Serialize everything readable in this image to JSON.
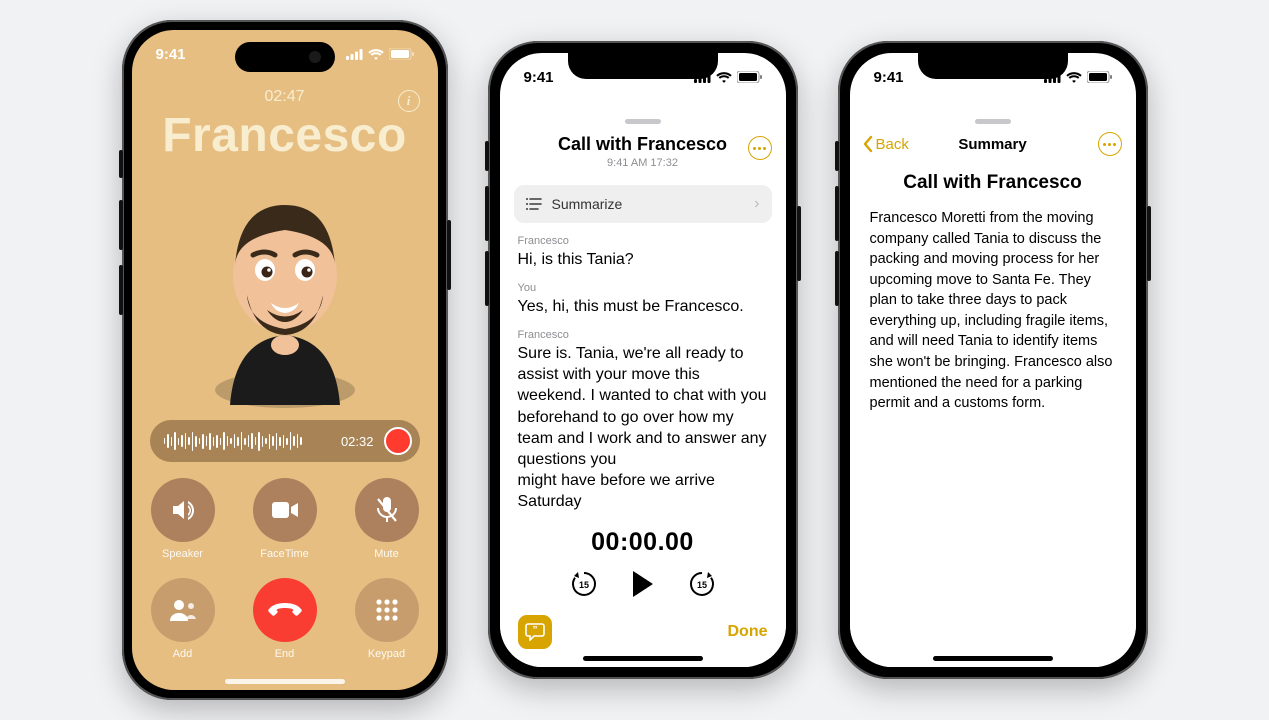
{
  "status_bar": {
    "time": "9:41"
  },
  "phone1": {
    "call_duration": "02:47",
    "caller_name": "Francesco",
    "recording_time": "02:32",
    "buttons": {
      "speaker": "Speaker",
      "facetime": "FaceTime",
      "mute": "Mute",
      "add": "Add",
      "end": "End",
      "keypad": "Keypad"
    }
  },
  "phone2": {
    "title": "Call with Francesco",
    "subtitle": "9:41 AM  17:32",
    "summarize_label": "Summarize",
    "transcript": [
      {
        "speaker": "Francesco",
        "text": "Hi, is this Tania?"
      },
      {
        "speaker": "You",
        "text": "Yes, hi, this must be Francesco."
      },
      {
        "speaker": "Francesco",
        "text": "Sure is. Tania, we're all ready to assist with your move this weekend. I wanted to chat with you beforehand to go over how my team and I work and to answer any questions you might have before we arrive Saturday"
      }
    ],
    "player_time": "00:00.00",
    "skip_seconds": "15",
    "done_label": "Done"
  },
  "phone3": {
    "back_label": "Back",
    "nav_title": "Summary",
    "heading": "Call with Francesco",
    "body": "Francesco Moretti from the moving company called Tania to discuss the packing and moving process for her upcoming move to Santa Fe. They plan to take three days to pack everything up, including fragile items, and will need Tania to identify items she won't be bringing. Francesco also mentioned the need for a parking permit and a customs form."
  }
}
